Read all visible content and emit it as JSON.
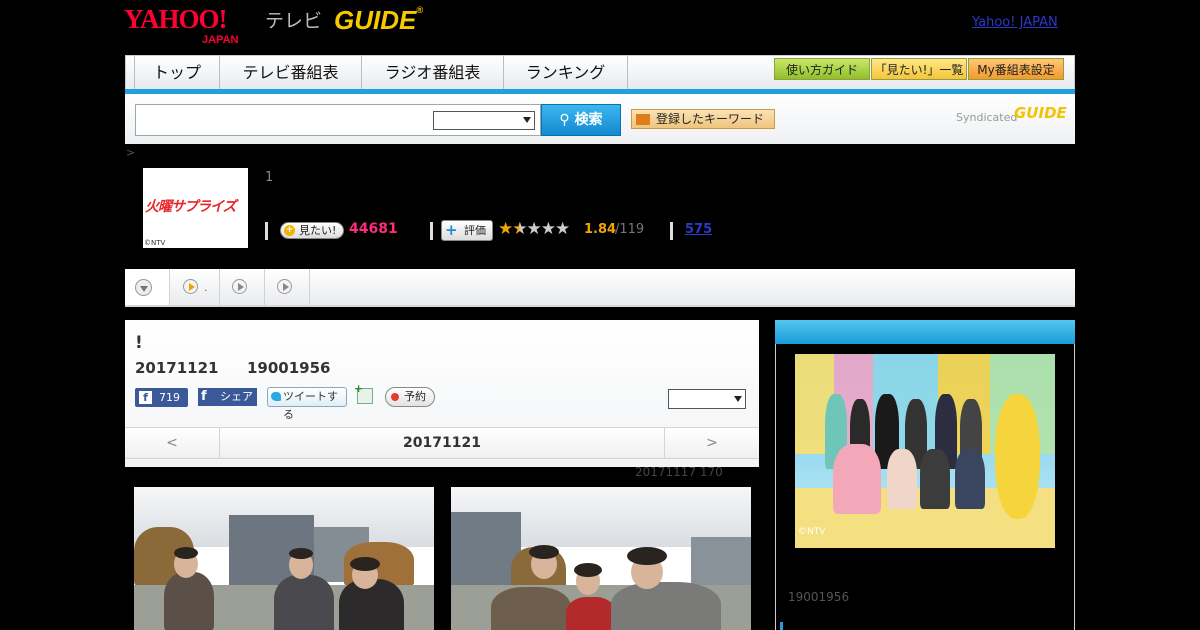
{
  "header": {
    "yahoo_logo": "YAHOO!",
    "yahoo_sub": "JAPAN",
    "tv_label": "テレビ",
    "gguide_logo": "GUIDE",
    "reg_mark": "®",
    "yj_link": "Yahoo! JAPAN"
  },
  "nav": {
    "tabs": [
      "トップ",
      "テレビ番組表",
      "ラジオ番組表",
      "ランキング"
    ],
    "guide_buttons": [
      "使い方ガイド",
      "「見たい!」一覧",
      "My番組表設定"
    ]
  },
  "search": {
    "button": "検索",
    "keyword_button": "登録したキーワード",
    "syndicated": "Syndicated",
    "syn_logo": "GUIDE"
  },
  "program": {
    "crumb": ">",
    "thumb_title": "火曜サプライズ",
    "thumb_copy": "©NTV",
    "episode_num": "1",
    "mitai_label": "見たい!",
    "mitai_count": "44681",
    "hyoka_label": "評価",
    "rating": 1.84,
    "rating_display": "1.84",
    "rating_count": "/119",
    "reviews": "575"
  },
  "episode": {
    "title": "!",
    "date": "20171121",
    "id": "19001956",
    "like_count": "719",
    "share_label": "シェア",
    "tweet_label": "ツイートする",
    "yoyaku_label": "予約",
    "nav_prev": "<",
    "nav_date": "20171121",
    "nav_next": ">",
    "posted": "20171117  170"
  },
  "sidebar": {
    "photo_copy": "©NTV",
    "id": "19001956"
  },
  "colors": {
    "accent_blue": "#1ea1dc",
    "pink_count": "#ff2b7a",
    "star_orange": "#f0a500",
    "facebook": "#3b5998"
  }
}
